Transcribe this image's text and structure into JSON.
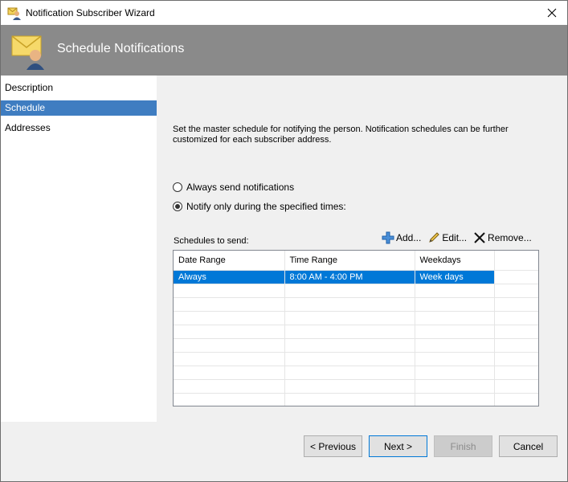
{
  "window": {
    "title": "Notification Subscriber Wizard",
    "app_icon": "subscriber-wizard-icon",
    "close_icon": "close-icon"
  },
  "banner": {
    "title": "Schedule Notifications",
    "icon": "envelope-person-icon"
  },
  "sidebar": {
    "items": [
      {
        "label": "Description",
        "selected": false
      },
      {
        "label": "Schedule",
        "selected": true
      },
      {
        "label": "Addresses",
        "selected": false
      }
    ]
  },
  "content": {
    "description": "Set the master schedule for notifying the person. Notification schedules can be further customized for each subscriber address.",
    "options": [
      {
        "label": "Always send notifications",
        "checked": false
      },
      {
        "label": "Notify only during the specified times:",
        "checked": true
      }
    ],
    "schedules_label": "Schedules to send:",
    "toolbar": {
      "add": "Add...",
      "edit": "Edit...",
      "remove": "Remove..."
    },
    "grid": {
      "columns": [
        "Date Range",
        "Time Range",
        "Weekdays"
      ],
      "rows": [
        [
          "Always",
          "8:00 AM - 4:00 PM",
          "Week days"
        ]
      ]
    }
  },
  "footer": {
    "previous": "< Previous",
    "next": "Next >",
    "finish": "Finish",
    "cancel": "Cancel"
  },
  "colors": {
    "selection": "#0078d7",
    "sidebar_selected": "#3f7dc1",
    "banner": "#8a8a8a"
  }
}
